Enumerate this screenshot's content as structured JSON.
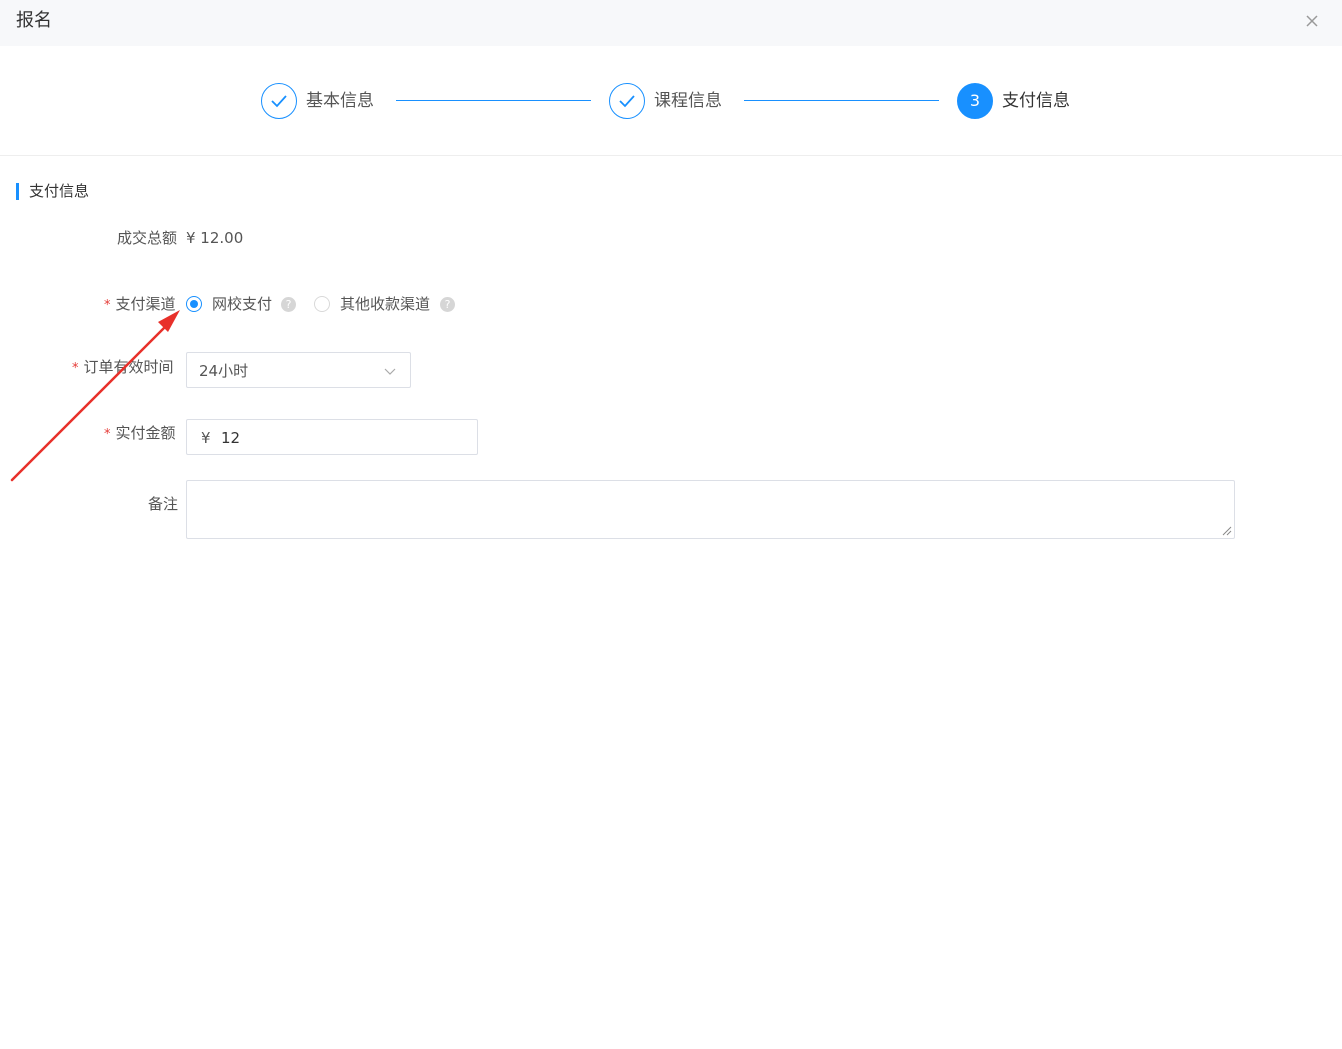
{
  "dialog": {
    "title": "报名",
    "close_icon": "close-icon"
  },
  "steps": [
    {
      "label": "基本信息",
      "state": "done"
    },
    {
      "label": "课程信息",
      "state": "done"
    },
    {
      "label": "支付信息",
      "state": "active",
      "number": "3"
    }
  ],
  "section": {
    "title": "支付信息"
  },
  "form": {
    "total": {
      "label": "成交总额",
      "value": "¥ 12.00"
    },
    "channel": {
      "required_mark": "*",
      "label": "支付渠道",
      "options": [
        {
          "label": "网校支付",
          "checked": true,
          "help": "?"
        },
        {
          "label": "其他收款渠道",
          "checked": false,
          "help": "?"
        }
      ]
    },
    "validity": {
      "required_mark": "*",
      "label": "订单有效时间",
      "value": "24小时"
    },
    "paid": {
      "required_mark": "*",
      "label": "实付金额",
      "prefix": "¥",
      "value": "12"
    },
    "remark": {
      "label": "备注",
      "value": ""
    }
  },
  "colors": {
    "accent": "#1890ff",
    "required": "#e53935",
    "annotation_arrow": "#e8302a"
  }
}
